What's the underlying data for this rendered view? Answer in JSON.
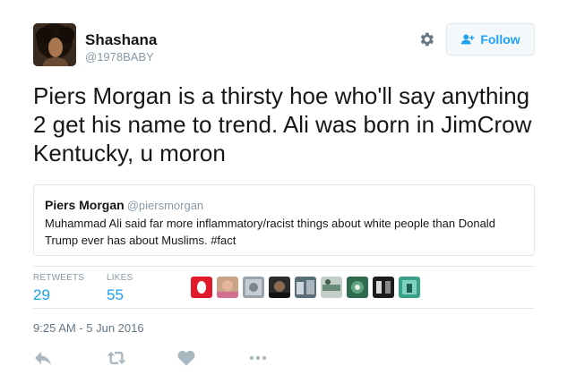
{
  "user": {
    "display_name": "Shashana",
    "handle": "@1978BABY"
  },
  "header": {
    "follow_label": "Follow",
    "settings_icon": "gear-icon",
    "follow_icon": "add-user-icon"
  },
  "tweet": {
    "text": "Piers Morgan is a thirsty hoe who'll say anything 2 get his name to trend. Ali was born in JimCrow Kentucky, u moron"
  },
  "quoted_tweet": {
    "name": "Piers Morgan",
    "handle": "@piersmorgan",
    "text": "Muhammad Ali said far more inflammatory/racist things about white people than Donald Trump ever has about Muslims. #fact"
  },
  "stats": {
    "retweets_label": "RETWEETS",
    "retweets_value": "29",
    "likes_label": "LIKES",
    "likes_value": "55"
  },
  "timestamp": "9:25 AM - 5 Jun 2016",
  "actions": [
    "reply-icon",
    "retweet-icon",
    "like-icon",
    "more-icon"
  ],
  "colors": {
    "accent": "#1da1f2",
    "muted": "#8899a6",
    "border": "#e1e8ed",
    "action_icon": "#aab8c2"
  }
}
